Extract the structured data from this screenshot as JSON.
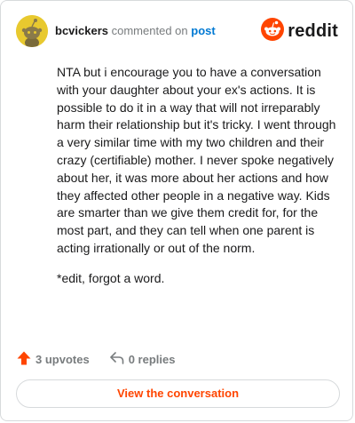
{
  "header": {
    "username": "bcvickers",
    "commented_on": "commented on",
    "post_link": "post",
    "brand": "reddit"
  },
  "comment": {
    "paragraphs": [
      "NTA but i encourage you to have a conversation with your daughter about your ex's actions. It is possible to do it in a way that will not irreparably harm their relationship but it's tricky. I went through a very similar time with my two children and their crazy (certifiable) mother. I never spoke negatively about her, it was more about her actions and how they affected other people in a negative way. Kids are smarter than we give them credit for, for the most part, and they can tell when one parent is acting irrationally or out of the norm.",
      "*edit, forgot a word."
    ]
  },
  "actions": {
    "upvotes": "3 upvotes",
    "replies": "0 replies"
  },
  "footer": {
    "view_label": "View the conversation"
  },
  "colors": {
    "accent": "#ff4500",
    "link": "#0079d3",
    "avatar": "#e8c92f"
  },
  "icons": {
    "avatar": "snoo-avatar-icon",
    "brand": "reddit-logo-icon",
    "upvote": "upvote-arrow-icon",
    "reply": "reply-arrow-icon"
  }
}
